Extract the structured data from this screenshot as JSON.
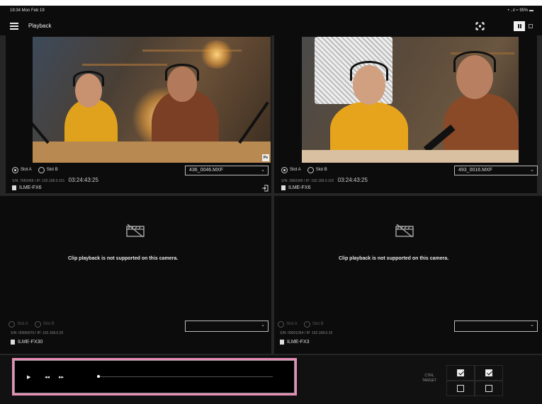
{
  "status_bar": {
    "time": "19:34 Mon Feb 19",
    "right": "• ..ıl ≈ 95% ▬"
  },
  "header": {
    "title": "Playback",
    "menu_icon": "hamburger-icon",
    "fullscreen_icon": "fullscreen-icon",
    "layout_icon": "grid-layout-icon"
  },
  "cameras": [
    {
      "slot_a": "Slot A",
      "slot_b": "Slot B",
      "selected_slot": "A",
      "clip": "436_0046.MXF",
      "network": "S/N: 7683456 / IP: 192.168.0.101",
      "timecode": "03:24:43:25",
      "model": "ILME-FX6",
      "badge": "Ps"
    },
    {
      "slot_a": "Slot A",
      "slot_b": "Slot B",
      "selected_slot": "A",
      "clip": "493_0016.MXF",
      "network": "S/N: 3960345 / IP: 192.168.0.102",
      "timecode": "03:24:43:25",
      "model": "ILME-FX6"
    },
    {
      "slot_a": "Slot A",
      "slot_b": "Slot B",
      "message": "Clip playback is not supported on this camera.",
      "clip": "",
      "network": "S/N: 00000070 / IP: 192.168.0.20",
      "model": "ILME-FX30"
    },
    {
      "slot_a": "Slot A",
      "slot_b": "Slot B",
      "message": "Clip playback is not supported on this camera.",
      "clip": "",
      "network": "S/N: 00001054 / IP: 192.168.0.16",
      "model": "ILME-FX3"
    }
  ],
  "transport": {
    "play": "▶",
    "prev": "◂◂",
    "next": "▸▸",
    "seek_position": 0.0
  },
  "ctrl_target": {
    "label_line1": "CTRL",
    "label_line2": "TARGET",
    "checks": [
      true,
      true,
      false,
      false
    ]
  },
  "colors": {
    "background": "#0c0c0c",
    "highlight": "#e58fb5"
  }
}
